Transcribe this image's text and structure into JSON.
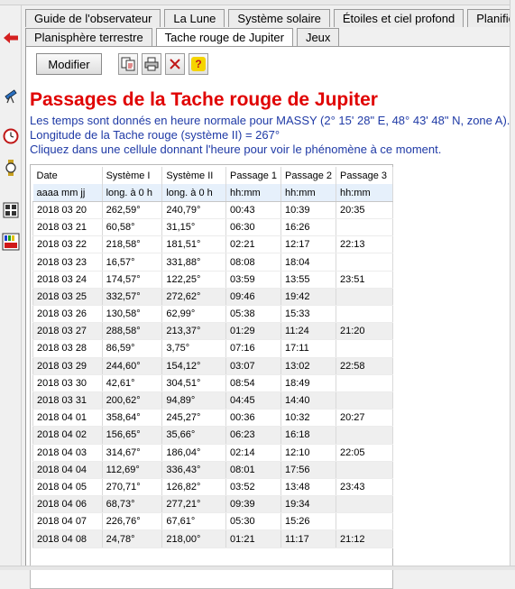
{
  "top_tabs": [
    "Guide de l'observateur",
    "La Lune",
    "Système solaire",
    "Étoiles et ciel profond",
    "Planificat"
  ],
  "sub_tabs": [
    {
      "label": "Planisphère terrestre",
      "active": false
    },
    {
      "label": "Tache rouge de Jupiter",
      "active": true
    },
    {
      "label": "Jeux",
      "active": false
    }
  ],
  "toolbar": {
    "modifier_label": "Modifier",
    "help_glyph": "?"
  },
  "heading": "Passages de la Tache rouge de Jupiter",
  "info_lines": [
    "Les temps sont donnés en heure normale pour MASSY (2° 15' 28\" E, 48° 43' 48\" N, zone A).",
    "Longitude de la Tache rouge (système II) = 267°",
    "Cliquez dans une cellule donnant l'heure pour voir le phénomène à ce moment."
  ],
  "table": {
    "headers": [
      "Date",
      "Système I",
      "Système II",
      "Passage 1",
      "Passage 2",
      "Passage 3"
    ],
    "subheaders": [
      "aaaa mm jj",
      "long. à 0 h",
      "long. à 0 h",
      "hh:mm",
      "hh:mm",
      "hh:mm"
    ],
    "rows": [
      [
        "2018 03 20",
        "262,59°",
        "240,79°",
        "00:43",
        "10:39",
        "20:35"
      ],
      [
        "2018 03 21",
        "60,58°",
        "31,15°",
        "06:30",
        "16:26",
        ""
      ],
      [
        "2018 03 22",
        "218,58°",
        "181,51°",
        "02:21",
        "12:17",
        "22:13"
      ],
      [
        "2018 03 23",
        "16,57°",
        "331,88°",
        "08:08",
        "18:04",
        ""
      ],
      [
        "2018 03 24",
        "174,57°",
        "122,25°",
        "03:59",
        "13:55",
        "23:51"
      ],
      [
        "2018 03 25",
        "332,57°",
        "272,62°",
        "09:46",
        "19:42",
        ""
      ],
      [
        "2018 03 26",
        "130,58°",
        "62,99°",
        "05:38",
        "15:33",
        ""
      ],
      [
        "2018 03 27",
        "288,58°",
        "213,37°",
        "01:29",
        "11:24",
        "21:20"
      ],
      [
        "2018 03 28",
        "86,59°",
        "3,75°",
        "07:16",
        "17:11",
        ""
      ],
      [
        "2018 03 29",
        "244,60°",
        "154,12°",
        "03:07",
        "13:02",
        "22:58"
      ],
      [
        "2018 03 30",
        "42,61°",
        "304,51°",
        "08:54",
        "18:49",
        ""
      ],
      [
        "2018 03 31",
        "200,62°",
        "94,89°",
        "04:45",
        "14:40",
        ""
      ],
      [
        "2018 04 01",
        "358,64°",
        "245,27°",
        "00:36",
        "10:32",
        "20:27"
      ],
      [
        "2018 04 02",
        "156,65°",
        "35,66°",
        "06:23",
        "16:18",
        ""
      ],
      [
        "2018 04 03",
        "314,67°",
        "186,04°",
        "02:14",
        "12:10",
        "22:05"
      ],
      [
        "2018 04 04",
        "112,69°",
        "336,43°",
        "08:01",
        "17:56",
        ""
      ],
      [
        "2018 04 05",
        "270,71°",
        "126,82°",
        "03:52",
        "13:48",
        "23:43"
      ],
      [
        "2018 04 06",
        "68,73°",
        "277,21°",
        "09:39",
        "19:34",
        ""
      ],
      [
        "2018 04 07",
        "226,76°",
        "67,61°",
        "05:30",
        "15:26",
        ""
      ],
      [
        "2018 04 08",
        "24,78°",
        "218,00°",
        "01:21",
        "11:17",
        "21:12"
      ]
    ]
  }
}
